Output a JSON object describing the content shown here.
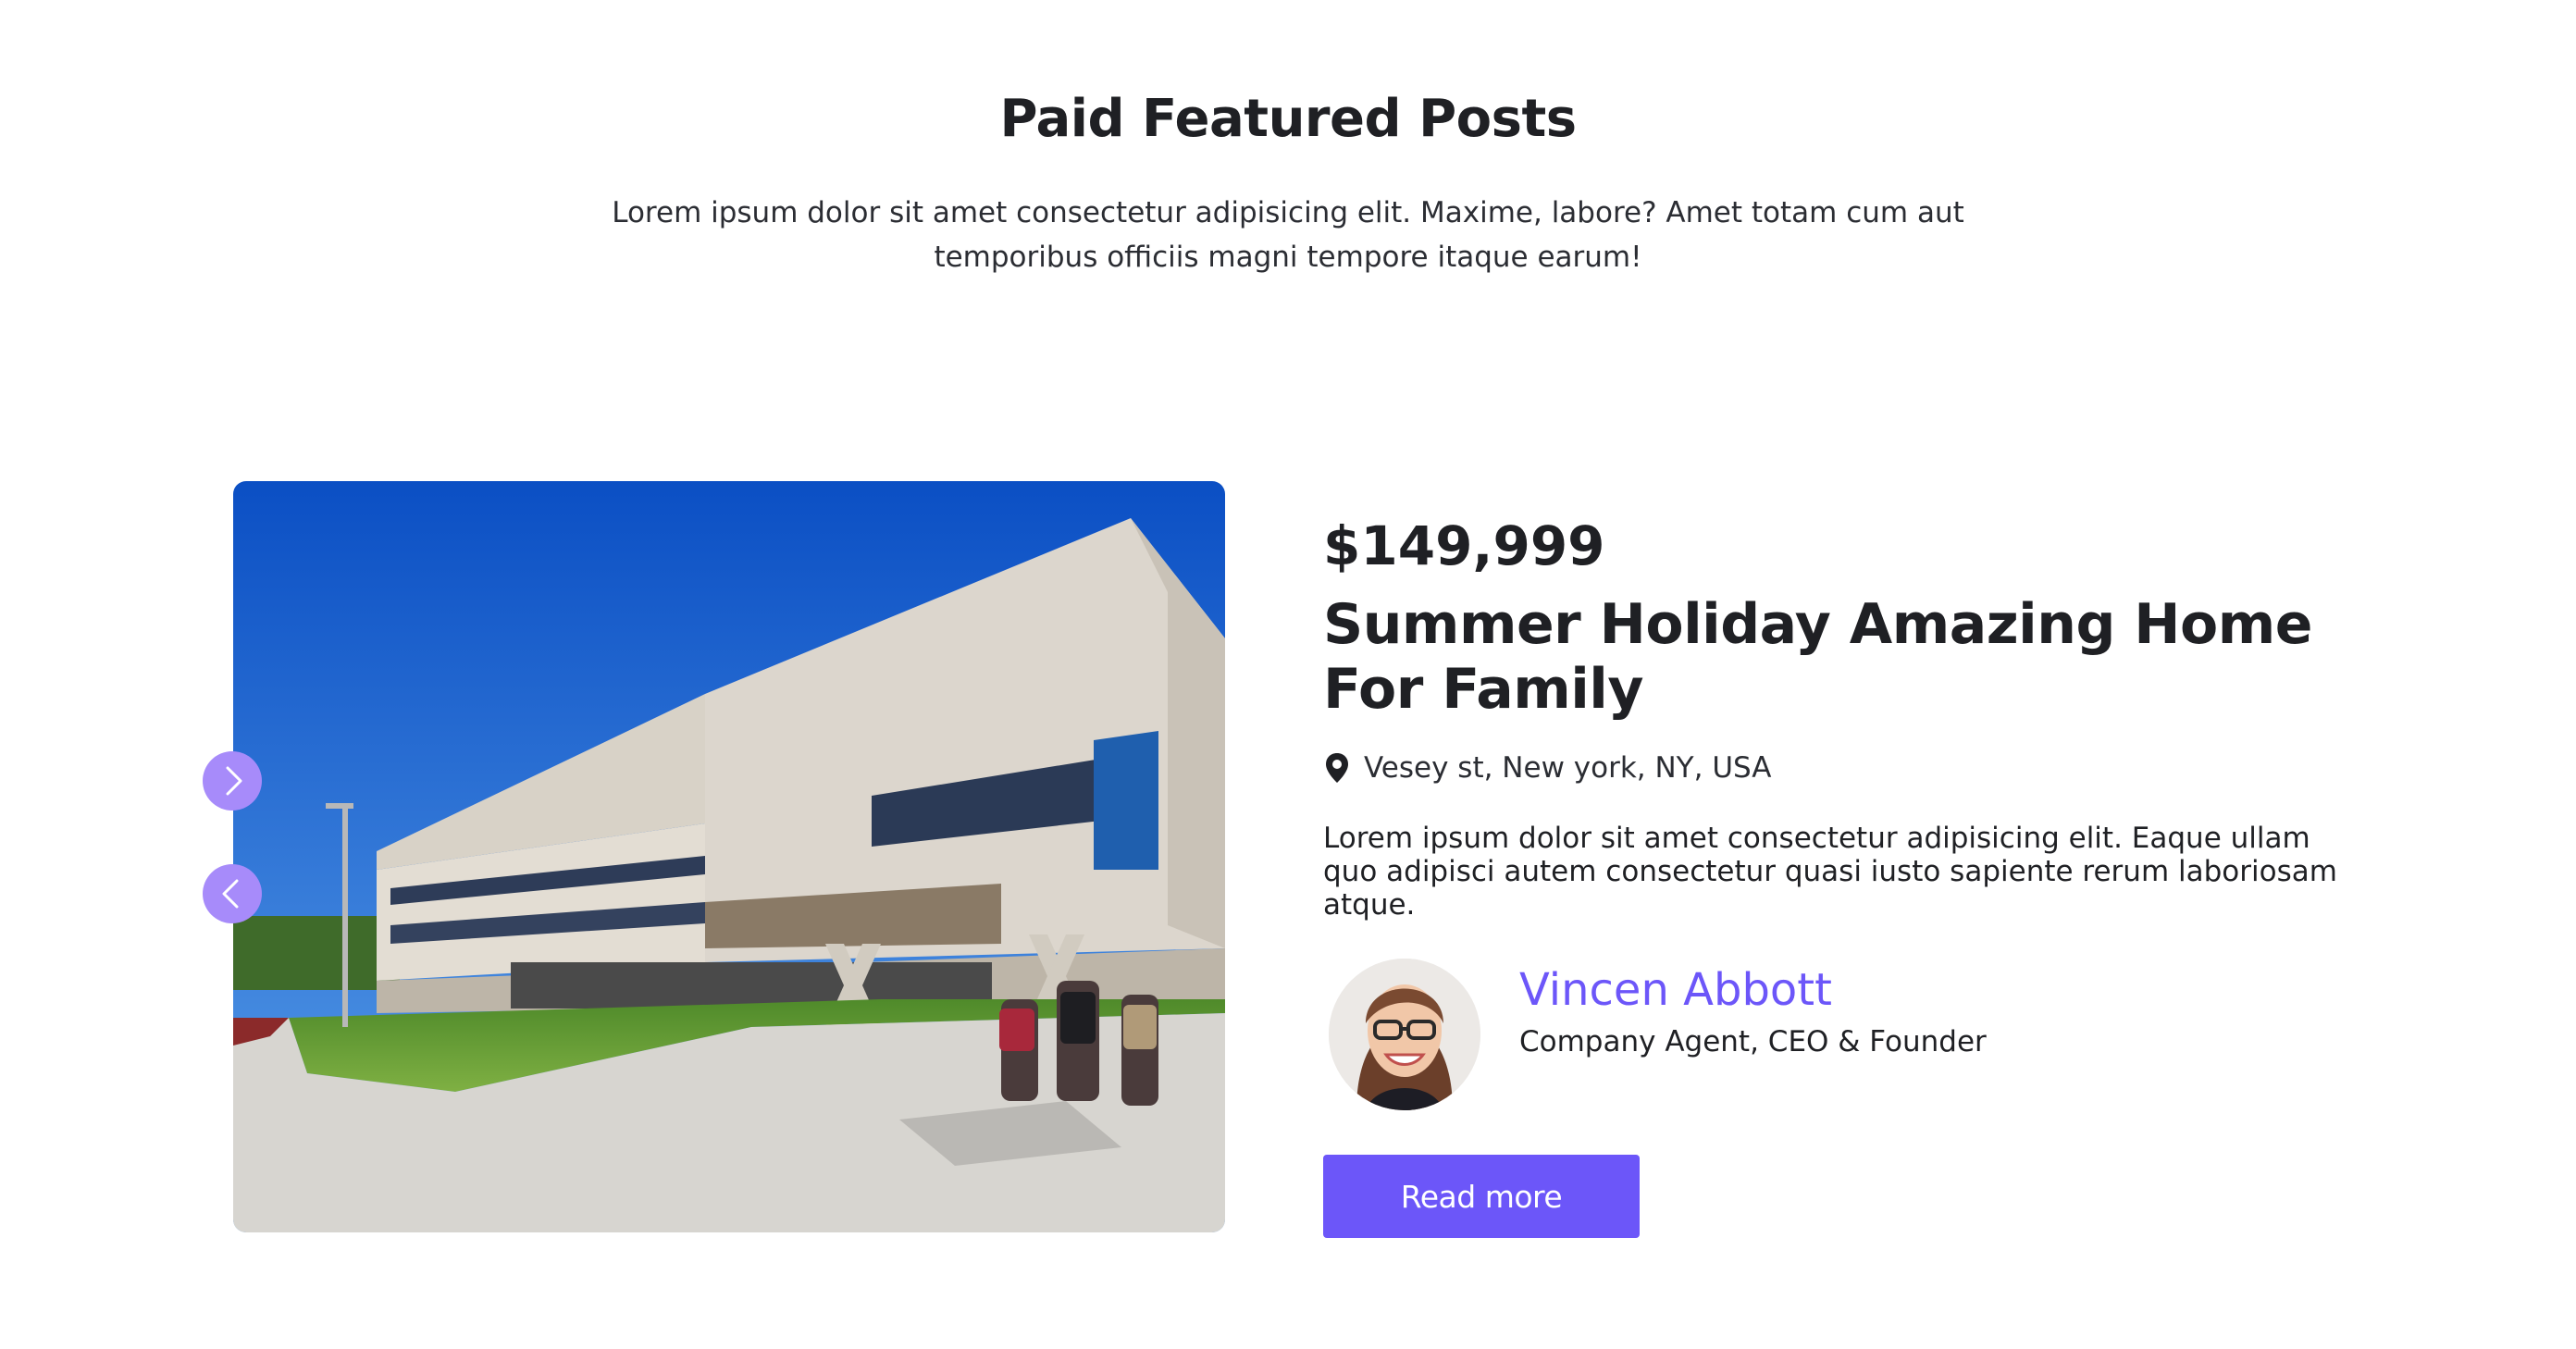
{
  "section": {
    "title": "Paid Featured Posts",
    "description": "Lorem ipsum dolor sit amet consectetur adipisicing elit. Maxime, labore? Amet totam cum aut temporibus officiis magni tempore itaque earum!"
  },
  "carousel": {
    "next_icon": "chevron-right-icon",
    "prev_icon": "chevron-left-icon",
    "nav_color": "#a78bfa"
  },
  "listing": {
    "price": "$149,999",
    "title": "Summer Holiday Amazing Home For Family",
    "location_icon": "map-pin-icon",
    "location": "Vesey st, New york, NY, USA",
    "description": "Lorem ipsum dolor sit amet consectetur adipisicing elit. Eaque ullam quo adipisci autem consectetur quasi iusto sapiente rerum laboriosam atque."
  },
  "agent": {
    "name": "Vincen Abbott",
    "role": "Company Agent, CEO & Founder",
    "name_color": "#6c56f9"
  },
  "actions": {
    "read_more_label": "Read more",
    "button_color": "#6c56f9"
  }
}
